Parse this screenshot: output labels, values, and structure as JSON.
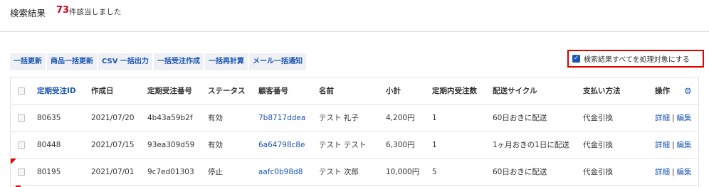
{
  "header": {
    "title": "検索結果",
    "count": "73",
    "count_suffix": "件該当しました"
  },
  "bulk_actions": [
    "一括更新",
    "商品一括更新",
    "CSV 一括出力",
    "一括受注作成",
    "一括再計算",
    "メール一括通知"
  ],
  "select_all": {
    "label": "検索結果すべてを処理対象にする",
    "checked": true
  },
  "table": {
    "columns": {
      "id": "定期受注ID",
      "date": "作成日",
      "order_no": "定期受注番号",
      "status": "ステータス",
      "customer_no": "顧客番号",
      "name": "名前",
      "subtotal": "小計",
      "order_count": "定期内受注数",
      "cycle": "配送サイクル",
      "payment": "支払い方法",
      "ops": "操作"
    },
    "rows": [
      {
        "id": "80635",
        "date": "2021/07/20",
        "order_no": "4b43a59b2f",
        "status": "有効",
        "customer_no": "7b8717ddea",
        "name": "テスト 礼子",
        "subtotal": "4,200円",
        "order_count": "1",
        "cycle": "60日おきに配送",
        "payment": "代金引換",
        "detail": "詳細",
        "sep": "|",
        "edit": "編集"
      },
      {
        "id": "80448",
        "date": "2021/07/15",
        "order_no": "93ea309d59",
        "status": "有効",
        "customer_no": "6a64798c8e",
        "name": "テスト テスト",
        "subtotal": "6,300円",
        "order_count": "1",
        "cycle": "1ヶ月おきの1日に配送",
        "payment": "代金引換",
        "detail": "詳細",
        "sep": "|",
        "edit": "編集"
      },
      {
        "id": "80195",
        "date": "2021/07/01",
        "order_no": "9c7ed01303",
        "status": "停止",
        "customer_no": "aafc0b98d8",
        "name": "テスト 次郎",
        "subtotal": "10,000円",
        "order_count": "5",
        "cycle": "60日おきに配送",
        "payment": "代金引換",
        "detail": "詳細",
        "sep": "|",
        "edit": "編集"
      }
    ]
  },
  "icons": {
    "settings": "gear-icon",
    "checkbox_checked": "check-icon"
  },
  "colors": {
    "accent": "#1a55b5",
    "count": "#d0021b",
    "highlight_border": "#e00000"
  }
}
